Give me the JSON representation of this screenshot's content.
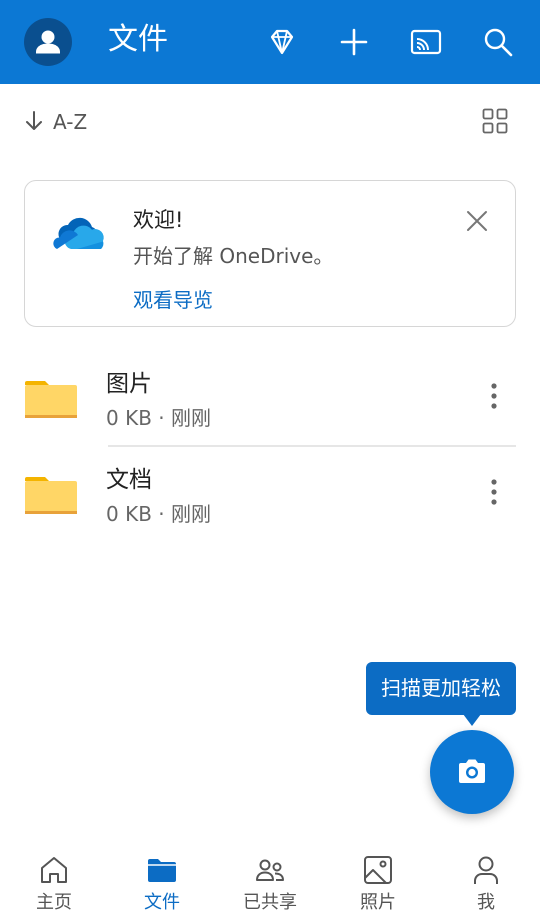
{
  "header": {
    "title": "文件",
    "icons": [
      "diamond-icon",
      "plus-icon",
      "cast-icon",
      "search-icon"
    ],
    "bg_color": "#0c78d4"
  },
  "sort": {
    "label": "A-Z",
    "view_icon": "grid-view-icon"
  },
  "welcome": {
    "title": "欢迎!",
    "subtitle": "开始了解 OneDrive。",
    "link": "观看导览"
  },
  "files": [
    {
      "name": "图片",
      "meta": "0 KB · 刚刚"
    },
    {
      "name": "文档",
      "meta": "0 KB · 刚刚"
    }
  ],
  "tooltip": {
    "text": "扫描更加轻松"
  },
  "fab": {
    "icon": "camera-icon"
  },
  "nav": [
    {
      "label": "主页",
      "icon": "home-icon",
      "active": false
    },
    {
      "label": "文件",
      "icon": "folder-icon",
      "active": true
    },
    {
      "label": "已共享",
      "icon": "shared-icon",
      "active": false
    },
    {
      "label": "照片",
      "icon": "photo-icon",
      "active": false
    },
    {
      "label": "我",
      "icon": "person-icon",
      "active": false
    }
  ],
  "colors": {
    "accent": "#0c78d4",
    "link": "#0c6cc4",
    "folder": "#ffd666"
  }
}
